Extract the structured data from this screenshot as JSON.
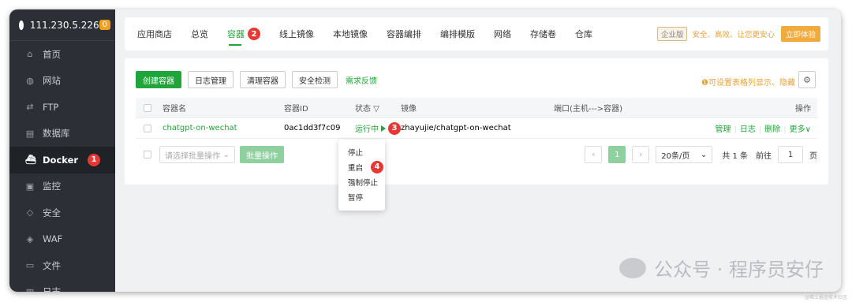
{
  "sidebar": {
    "host": "111.230.5.226",
    "alert_count": "0",
    "items": [
      {
        "label": "首页",
        "icon": "home-icon",
        "glyph": "⌂"
      },
      {
        "label": "网站",
        "icon": "globe-icon",
        "glyph": "◍"
      },
      {
        "label": "FTP",
        "icon": "ftp-icon",
        "glyph": "⇄"
      },
      {
        "label": "数据库",
        "icon": "database-icon",
        "glyph": "▤"
      },
      {
        "label": "Docker",
        "icon": "docker-icon",
        "glyph": "⛴",
        "active": true,
        "marker": "1"
      },
      {
        "label": "监控",
        "icon": "monitor-icon",
        "glyph": "▣"
      },
      {
        "label": "安全",
        "icon": "shield-icon",
        "glyph": "◇"
      },
      {
        "label": "WAF",
        "icon": "waf-icon",
        "glyph": "◈"
      },
      {
        "label": "文件",
        "icon": "folder-icon",
        "glyph": "▭"
      },
      {
        "label": "日志",
        "icon": "log-icon",
        "glyph": "▥"
      }
    ]
  },
  "tabs": [
    "应用商店",
    "总览",
    "容器",
    "线上镜像",
    "本地镜像",
    "容器编排",
    "编排模版",
    "网络",
    "存储卷",
    "仓库"
  ],
  "active_tab_marker": "2",
  "promo": {
    "badge": "企业版",
    "text": "安全、高效、让您更安心",
    "button": "立即体验"
  },
  "toolbar": {
    "create": "创建容器",
    "logs": "日志管理",
    "clean": "清理容器",
    "check": "安全检测",
    "feedback": "需求反馈",
    "hint": "❶可设置表格列显示、隐藏"
  },
  "table": {
    "headers": {
      "name": "容器名",
      "id": "容器ID",
      "status": "状态 ▽",
      "image": "镜像",
      "port": "端口(主机--->容器)",
      "op": "操作"
    },
    "row": {
      "name": "chatgpt-on-wechat",
      "id": "0ac1dd3f7c09",
      "status": "运行中",
      "status_marker": "3",
      "image": "zhayujie/chatgpt-on-wechat",
      "port": "",
      "ops": [
        "管理",
        "日志",
        "删除",
        "更多∨"
      ]
    }
  },
  "footer": {
    "batch_select": "请选择批量操作",
    "batch_button": "批量操作",
    "prev": "‹",
    "page": "1",
    "next": "›",
    "page_size": "20条/页",
    "total": "共 1 条",
    "goto_label": "前往",
    "goto_value": "1",
    "goto_unit": "页"
  },
  "dropdown": {
    "items": [
      {
        "label": "停止"
      },
      {
        "label": "重启",
        "marker": "4"
      },
      {
        "label": "强制停止"
      },
      {
        "label": "暂停"
      }
    ]
  },
  "watermark": "公众号 · 程序员安仔",
  "credit": "@稀土掘金技术社区",
  "colors": {
    "accent": "#20a53a",
    "marker": "#e53935",
    "sidebar": "#2c3036",
    "warning": "#e6a23c"
  }
}
